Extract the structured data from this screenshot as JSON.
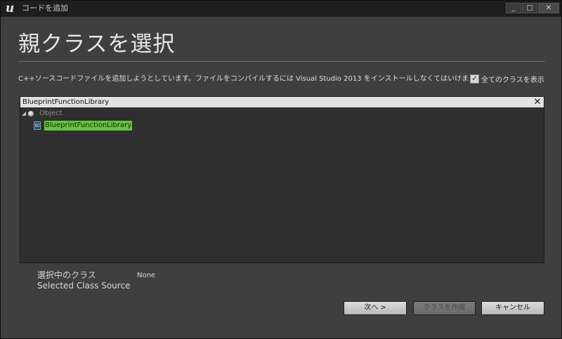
{
  "window": {
    "title": "コードを追加",
    "logo": "u",
    "controls": {
      "minimize": "_",
      "maximize": "□",
      "close": "✕"
    }
  },
  "header": {
    "title": "親クラスを選択",
    "description": "C++ソースコードファイルを追加しようとしています。ファイルをコンパイルするには Visual Studio 2013 をインストールしなくてはいけま"
  },
  "show_all_classes": {
    "label": "全てのクラスを表示",
    "checked": true,
    "check_glyph": "✓"
  },
  "search": {
    "value": "BlueprintFunctionLibrary",
    "clear_glyph": "✕"
  },
  "tree": {
    "root": {
      "label": "Object",
      "expander": "◢",
      "icon": "sphere-icon"
    },
    "child": {
      "label": "BlueprintFunctionLibrary",
      "icon": "blueprint-class-icon",
      "icon_glyph": "Bl",
      "highlight_color": "#64c43a"
    }
  },
  "selection": {
    "label_ja": "選択中のクラス",
    "label_en": "Selected Class Source",
    "value": "None"
  },
  "buttons": {
    "next": "次へ >",
    "create": "クラスを作成",
    "cancel": "キャンセル"
  },
  "colors": {
    "background": "#3f3f3f",
    "titlebar": "#1e1e1e",
    "panel": "#2f2f2f",
    "match_highlight": "#64c43a"
  }
}
